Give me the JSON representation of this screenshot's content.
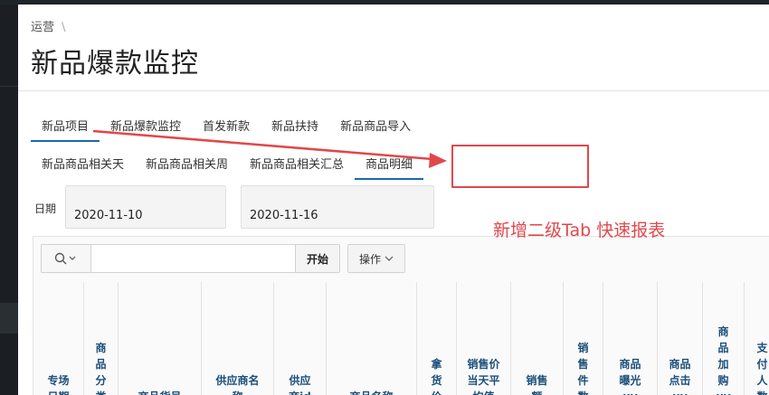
{
  "breadcrumb": {
    "item": "运营",
    "separator": "\\"
  },
  "page_title": "新品爆款监控",
  "tabs_level1": [
    {
      "label": "新品项目",
      "active": true
    },
    {
      "label": "新品爆款监控",
      "active": false
    },
    {
      "label": "首发新款",
      "active": false
    },
    {
      "label": "新品扶持",
      "active": false
    },
    {
      "label": "新品商品导入",
      "active": false
    }
  ],
  "tabs_level2": [
    {
      "label": "新品商品相关天",
      "active": false
    },
    {
      "label": "新品商品相关周",
      "active": false
    },
    {
      "label": "新品商品相关汇总",
      "active": false
    },
    {
      "label": "商品明细",
      "active": true
    }
  ],
  "filters": {
    "date_label": "日期",
    "date_from": "2020-11-10",
    "date_to": "2020-11-16"
  },
  "toolbar": {
    "search_value": "",
    "go_label": "开始",
    "actions_label": "操作"
  },
  "columns": [
    "专场日期",
    "商品分类",
    "商品货号",
    "供应商名称",
    "供应商id",
    "商品名称",
    "拿货价",
    "销售价当天平均值",
    "销售额",
    "销售件数",
    "商品曝光uv",
    "商品点击uv",
    "商品加购uv",
    "支付人数"
  ],
  "annotation": {
    "text": "新增二级Tab 快速报表",
    "color": "#e0484b"
  }
}
